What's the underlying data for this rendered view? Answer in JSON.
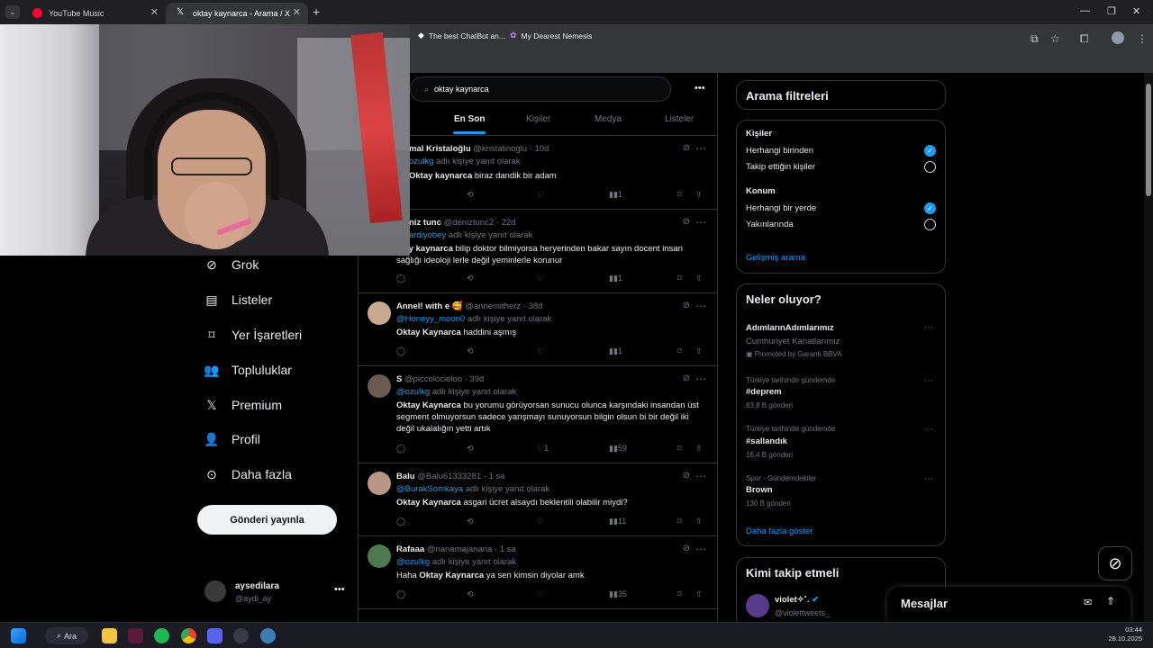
{
  "browser": {
    "tabs": [
      {
        "title": "YouTube Music",
        "active": false,
        "favicon_color": "#ff0033"
      },
      {
        "title": "oktay kaynarca - Arama / X",
        "active": true,
        "favicon_color": "#ffffff"
      }
    ],
    "new_tab_glyph": "+",
    "bookmarks": [
      {
        "label": "The best ChatBot an...",
        "icon": "diamond-icon"
      },
      {
        "label": "My Dearest Nemesis",
        "icon": "bookmark-page-icon"
      }
    ]
  },
  "search": {
    "query": "oktay kaynarca"
  },
  "tabs": [
    {
      "label": "En Son",
      "active": true
    },
    {
      "label": "Kişiler",
      "active": false
    },
    {
      "label": "Medya",
      "active": false
    },
    {
      "label": "Listeler",
      "active": false
    }
  ],
  "nav": {
    "items": [
      {
        "label": "Grok",
        "icon": "grok-icon"
      },
      {
        "label": "Listeler",
        "icon": "list-icon"
      },
      {
        "label": "Yer İşaretleri",
        "icon": "bookmark-icon"
      },
      {
        "label": "Topluluklar",
        "icon": "communities-icon"
      },
      {
        "label": "Premium",
        "icon": "x-logo-icon"
      },
      {
        "label": "Profil",
        "icon": "profile-icon"
      },
      {
        "label": "Daha fazla",
        "icon": "more-circle-icon"
      }
    ],
    "post_button": "Gönderi yayınla",
    "account": {
      "name": "aysedilara",
      "handle": "@aydi_ay"
    }
  },
  "posts": [
    {
      "name": "mal Kristaloğlu",
      "handle": "@kristalinoglu",
      "time": "· 10d",
      "mention": "ozulkg",
      "reply_suffix": "adlı kişiye yanıt olarak",
      "bold": "Oktay kaynarca",
      "text": " biraz dandik bir adam",
      "likes": "",
      "retweets": "",
      "views": "1"
    },
    {
      "name": "niz tunc",
      "handle": "@deniztunc2",
      "time": "· 22d",
      "mention": "ardiyobey",
      "reply_suffix": "adlı kişiye yanıt olarak",
      "bold": "ktay kaynarca",
      "text": " bilip doktor bilmiyorsa heryerinden bakar sayın docent insan sağlığı ideoloji lerle değil yeminlerle korunur",
      "likes": "",
      "retweets": "",
      "views": "1"
    },
    {
      "name": "Annel! with e 🥰",
      "handle": "@annemitherz",
      "time": "· 38d",
      "mention": "@Honeyy_moon0",
      "reply_suffix": "adlı kişiye yanıt olarak",
      "bold": "Oktay Kaynarca",
      "text": " haddini aşmış",
      "likes": "",
      "retweets": "",
      "views": "1"
    },
    {
      "name": "S",
      "handle": "@piccolocieloo",
      "time": "· 39d",
      "mention": "@ozulkg",
      "reply_suffix": "adlı kişiye yanıt olarak",
      "bold": "Oktay Kaynarca",
      "text": " bu yorumu görüyorsan sunucu olunca karşındaki insandan üst segment olmuyorsun sadece yarışmayı sunuyorsun bilgin olsun bi bir değil iki değil ukalalığın yetti artık",
      "likes": "1",
      "retweets": "",
      "views": "59"
    },
    {
      "name": "Balu",
      "handle": "@Balu61333281",
      "time": "· 1 sa",
      "mention": "@BurakSomkaya",
      "reply_suffix": "adlı kişiye yanıt olarak",
      "bold": "Oktay Kaynarca",
      "text": " asgari ücret alsaydı beklentili olabilir miydi?",
      "likes": "",
      "retweets": "",
      "views": "11"
    },
    {
      "name": "Rafaaa",
      "handle": "@nanamajanana",
      "time": "· 1 sa",
      "mention": "@ozulkg",
      "reply_suffix": "adlı kişiye yanıt olarak",
      "bold": "Oktay Kaynarca",
      "text_prefix": "Haha ",
      "text": " ya sen kimsin diyolar amk",
      "likes": "",
      "retweets": "",
      "views": "35"
    }
  ],
  "filters": {
    "title": "Arama filtreleri",
    "people_heading": "Kişiler",
    "people_opts": [
      {
        "label": "Herhangi birinden",
        "checked": true
      },
      {
        "label": "Takip ettiğin kişiler",
        "checked": false
      }
    ],
    "location_heading": "Konum",
    "location_opts": [
      {
        "label": "Herhangi bir yerde",
        "checked": true
      },
      {
        "label": "Yakınlarında",
        "checked": false
      }
    ],
    "advanced": "Gelişmiş arama"
  },
  "trends": {
    "title": "Neler oluyor?",
    "promo": {
      "name": "AdımlarınAdımlarımız",
      "sub": "Cumhuriyet Kanatlarımız",
      "promoted": "Promoted by Garanti BBVA"
    },
    "items": [
      {
        "context": "Türkiye tarihinde gündemde",
        "name": "#deprem",
        "count": "83,8 B gönderi"
      },
      {
        "context": "Türkiye tarihinde gündemde",
        "name": "#sallandık",
        "count": "16,4 B gönderi"
      },
      {
        "context": "Spor · Gündemdekiler",
        "name": "Brown",
        "count": "130 B gönderi"
      }
    ],
    "show_more": "Daha fazla göster"
  },
  "who_to_follow": {
    "title": "Kimi takip etmeli",
    "name": "violet✧˚.",
    "handle": "@violettweets_"
  },
  "messages": {
    "title": "Mesajlar"
  },
  "taskbar": {
    "search": "Ara",
    "time": "03:44",
    "date": "28.10.2025"
  },
  "colors": {
    "accent": "#1d9bf0",
    "background": "#000000",
    "border": "#2f3336",
    "muted": "#71767b"
  }
}
